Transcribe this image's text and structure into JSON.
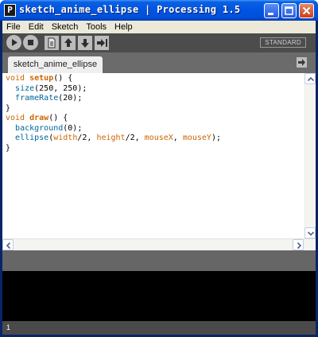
{
  "window": {
    "title": "sketch_anime_ellipse | Processing 1.5",
    "app_icon_letter": "P"
  },
  "menu": [
    "File",
    "Edit",
    "Sketch",
    "Tools",
    "Help"
  ],
  "toolbar": {
    "mode": "STANDARD",
    "buttons": [
      "run",
      "stop",
      "new",
      "open",
      "save",
      "export"
    ]
  },
  "tabs": [
    {
      "label": "sketch_anime_ellipse",
      "active": true
    }
  ],
  "editor": {
    "lines": [
      [
        {
          "t": "void",
          "c": "kw"
        },
        {
          "t": " "
        },
        {
          "t": "setup",
          "c": "kw-b"
        },
        {
          "t": "() {"
        }
      ],
      [
        {
          "t": "  "
        },
        {
          "t": "size",
          "c": "fn"
        },
        {
          "t": "(250, 250);"
        }
      ],
      [
        {
          "t": "  "
        },
        {
          "t": "frameRate",
          "c": "fn"
        },
        {
          "t": "(20);"
        }
      ],
      [
        {
          "t": "}"
        }
      ],
      [
        {
          "t": "void",
          "c": "kw"
        },
        {
          "t": " "
        },
        {
          "t": "draw",
          "c": "kw-b"
        },
        {
          "t": "() {"
        }
      ],
      [
        {
          "t": "  "
        },
        {
          "t": "background",
          "c": "fn"
        },
        {
          "t": "(0);"
        }
      ],
      [
        {
          "t": "  "
        },
        {
          "t": "ellipse",
          "c": "fn"
        },
        {
          "t": "("
        },
        {
          "t": "width",
          "c": "kw"
        },
        {
          "t": "/2, "
        },
        {
          "t": "height",
          "c": "kw"
        },
        {
          "t": "/2, "
        },
        {
          "t": "mouseX",
          "c": "kw"
        },
        {
          "t": ", "
        },
        {
          "t": "mouseY",
          "c": "kw"
        },
        {
          "t": ");"
        }
      ],
      [
        {
          "t": "}"
        }
      ]
    ]
  },
  "status": {
    "line_number": "1"
  },
  "colors": {
    "keyword": "#cc6600",
    "function": "#006699",
    "toolbar_bg": "#4c4c4c",
    "tabbar_bg": "#6b6b6b",
    "console_bg": "#000000"
  }
}
